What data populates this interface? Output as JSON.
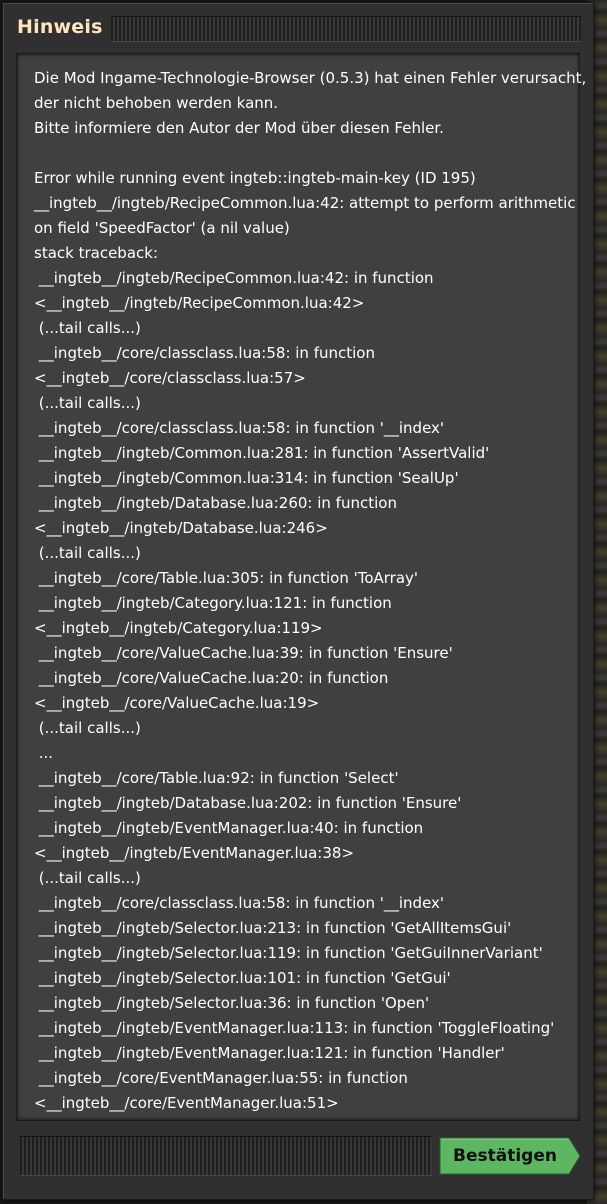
{
  "dialog": {
    "title": "Hinweis",
    "confirm_label": "Bestätigen",
    "lines": [
      "Die Mod Ingame-Technologie-Browser (0.5.3) hat einen Fehler verursacht,",
      "der nicht behoben werden kann.",
      "Bitte informiere den Autor der Mod über diesen Fehler.",
      "",
      "Error while running event ingteb::ingteb-main-key (ID 195)",
      "__ingteb__/ingteb/RecipeCommon.lua:42: attempt to perform arithmetic",
      "on field 'SpeedFactor' (a nil value)",
      "stack traceback:",
      " __ingteb__/ingteb/RecipeCommon.lua:42: in function",
      "<__ingteb__/ingteb/RecipeCommon.lua:42>",
      " (...tail calls...)",
      " __ingteb__/core/classclass.lua:58: in function",
      "<__ingteb__/core/classclass.lua:57>",
      " (...tail calls...)",
      " __ingteb__/core/classclass.lua:58: in function '__index'",
      " __ingteb__/ingteb/Common.lua:281: in function 'AssertValid'",
      " __ingteb__/ingteb/Common.lua:314: in function 'SealUp'",
      " __ingteb__/ingteb/Database.lua:260: in function",
      "<__ingteb__/ingteb/Database.lua:246>",
      " (...tail calls...)",
      " __ingteb__/core/Table.lua:305: in function 'ToArray'",
      " __ingteb__/ingteb/Category.lua:121: in function",
      "<__ingteb__/ingteb/Category.lua:119>",
      " __ingteb__/core/ValueCache.lua:39: in function 'Ensure'",
      " __ingteb__/core/ValueCache.lua:20: in function",
      "<__ingteb__/core/ValueCache.lua:19>",
      " (...tail calls...)",
      " ...",
      " __ingteb__/core/Table.lua:92: in function 'Select'",
      " __ingteb__/ingteb/Database.lua:202: in function 'Ensure'",
      " __ingteb__/ingteb/EventManager.lua:40: in function",
      "<__ingteb__/ingteb/EventManager.lua:38>",
      " (...tail calls...)",
      " __ingteb__/core/classclass.lua:58: in function '__index'",
      " __ingteb__/ingteb/Selector.lua:213: in function 'GetAllItemsGui'",
      " __ingteb__/ingteb/Selector.lua:119: in function 'GetGuiInnerVariant'",
      " __ingteb__/ingteb/Selector.lua:101: in function 'GetGui'",
      " __ingteb__/ingteb/Selector.lua:36: in function 'Open'",
      " __ingteb__/ingteb/EventManager.lua:113: in function 'ToggleFloating'",
      " __ingteb__/ingteb/EventManager.lua:121: in function 'Handler'",
      " __ingteb__/core/EventManager.lua:55: in function",
      "<__ingteb__/core/EventManager.lua:51>"
    ]
  },
  "colors": {
    "title": "#ffe6c0",
    "button_green": "#5eb663",
    "panel": "#414041"
  }
}
